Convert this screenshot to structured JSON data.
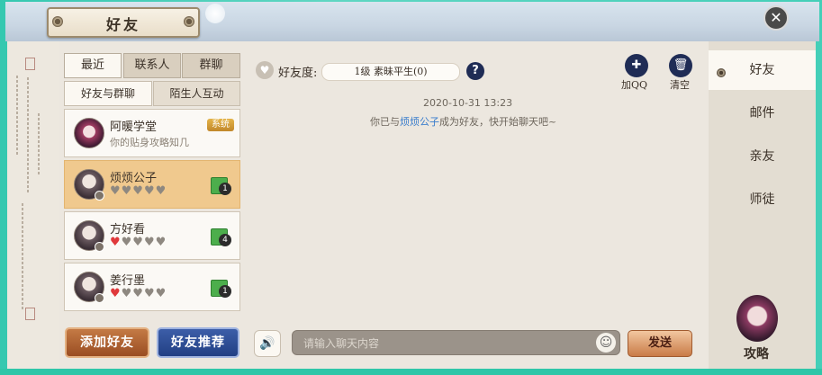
{
  "window": {
    "title": "好友",
    "close_glyph": "✕"
  },
  "tabs": [
    {
      "label": "最近",
      "active": true
    },
    {
      "label": "联系人",
      "active": false
    },
    {
      "label": "群聊",
      "active": false
    }
  ],
  "subtabs": [
    {
      "label": "好友与群聊",
      "active": true
    },
    {
      "label": "陌生人互动",
      "active": false
    }
  ],
  "contacts": [
    {
      "name": "阿暖学堂",
      "subtitle": "你的贴身攻略知几",
      "badge": "系统"
    },
    {
      "name": "烦烦公子",
      "hearts_filled": 0,
      "hearts_total": 5,
      "unread": "1",
      "selected": true
    },
    {
      "name": "方好看",
      "hearts_filled": 1,
      "hearts_total": 5,
      "unread": "4"
    },
    {
      "name": "姜行墨",
      "hearts_filled": 1,
      "hearts_total": 5,
      "unread": "1"
    }
  ],
  "buttons": {
    "add_friend": "添加好友",
    "recommend": "好友推荐"
  },
  "chat": {
    "favor_label": "好友度:",
    "favor_value": "1级 素昧平生(0)",
    "help": "?",
    "add_qq": "加QQ",
    "clear": "清空",
    "timestamp": "2020-10-31 13:23",
    "system_prefix": "你已与",
    "system_name": "烦烦公子",
    "system_suffix": "成为好友，快开始聊天吧~",
    "input_placeholder": "请输入聊天内容",
    "send": "发送"
  },
  "right_nav": [
    {
      "label": "好友",
      "active": true
    },
    {
      "label": "邮件",
      "active": false
    },
    {
      "label": "亲友",
      "active": false
    },
    {
      "label": "师徒",
      "active": false
    }
  ],
  "guide": {
    "label": "攻略"
  },
  "colors": {
    "selected_card": "#f0c98e",
    "heart_red": "#e0393b",
    "link_blue": "#3a7dcc",
    "navy": "#1f2c55"
  }
}
